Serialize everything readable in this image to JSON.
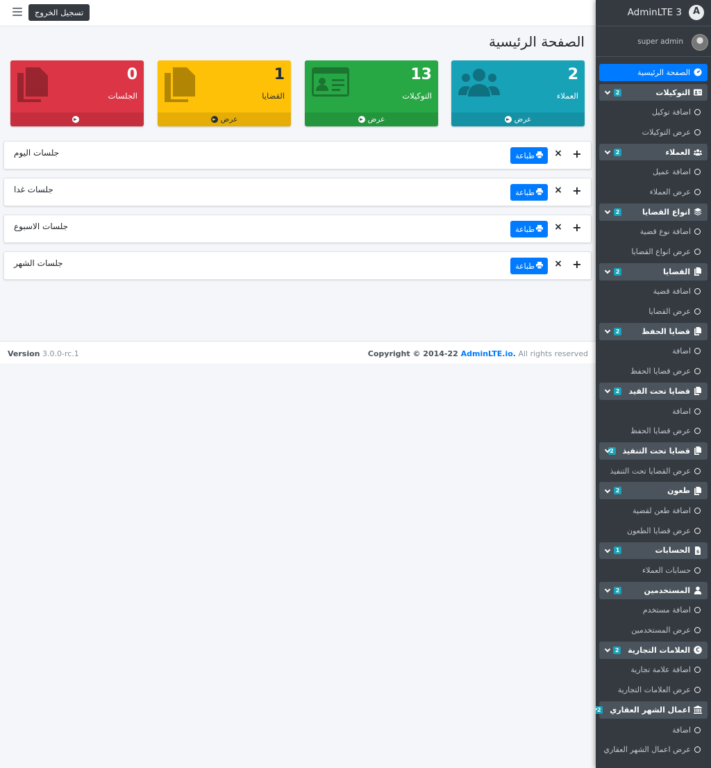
{
  "navbar": {
    "logout_label": "تسجيل الخروج",
    "menu_icon": "bars-icon"
  },
  "page": {
    "title": "الصفحة الرئيسية"
  },
  "stats": [
    {
      "value": "2",
      "label": "العملاء",
      "footer": "عرض",
      "color": "#17a2b8",
      "icon": "users-icon"
    },
    {
      "value": "13",
      "label": "التوكيلات",
      "footer": "عرض",
      "color": "#28a745",
      "icon": "id-card-icon"
    },
    {
      "value": "1",
      "label": "القضايا",
      "footer": "عرض",
      "color": "#ffc107",
      "icon": "copy-icon"
    },
    {
      "value": "0",
      "label": "الجلسات",
      "footer": "",
      "color": "#dc3545",
      "icon": "copy-icon"
    }
  ],
  "cards": [
    {
      "title": "جلسات اليوم",
      "print_label": "طباعة"
    },
    {
      "title": "جلسات غدا",
      "print_label": "طباعة"
    },
    {
      "title": "جلسات الاسبوع",
      "print_label": "طباعة"
    },
    {
      "title": "جلسات الشهر",
      "print_label": "طباعة"
    }
  ],
  "footer": {
    "version_label": "Version",
    "version": "3.0.0-rc.1",
    "copyright_prefix": "Copyright © 2014-22 ",
    "copyright_link": "AdminLTE.io.",
    "copyright_suffix": " All rights reserved"
  },
  "sidebar": {
    "brand": "AdminLTE 3",
    "user": "super admin",
    "home": "الصفحة الرئيسية",
    "groups": [
      {
        "label": "التوكيلات",
        "badge": "2",
        "icon": "id-card-icon",
        "items": [
          "اضافة توكيل",
          "عرض التوكيلات"
        ]
      },
      {
        "label": "العملاء",
        "badge": "2",
        "icon": "users-icon",
        "items": [
          "اضافة عميل",
          "عرض العملاء"
        ]
      },
      {
        "label": "انواع القضايا",
        "badge": "2",
        "icon": "layer-group-icon",
        "items": [
          "اضافة نوع قضية",
          "عرض انواع القضايا"
        ]
      },
      {
        "label": "القضايا",
        "badge": "2",
        "icon": "copy-icon",
        "items": [
          "اضافة قضية",
          "عرض القضايا"
        ]
      },
      {
        "label": "قضايا الحفظ",
        "badge": "2",
        "icon": "copy-icon",
        "items": [
          "اضافة",
          "عرض قضايا الحفظ"
        ]
      },
      {
        "label": "قضايا تحت القيد",
        "badge": "2",
        "icon": "copy-icon",
        "items": [
          "اضافة",
          "عرض قضايا الحفظ"
        ]
      },
      {
        "label": "قضايا تحت التنفيذ",
        "badge": "2",
        "icon": "copy-icon",
        "items": [
          "عرض القضايا تحت التنفيذ"
        ]
      },
      {
        "label": "طعون",
        "badge": "2",
        "icon": "copy-icon",
        "items": [
          "اضافة طعن لقضية",
          "عرض قضايا الطعون"
        ]
      },
      {
        "label": "الحسابات",
        "badge": "1",
        "icon": "file-invoice-icon",
        "items": [
          "حسابات العملاء"
        ]
      },
      {
        "label": "المستخدمين",
        "badge": "2",
        "icon": "user-icon",
        "items": [
          "اضافة مستخدم",
          "عرض المستخدمين"
        ]
      },
      {
        "label": "العلامات التجارية",
        "badge": "2",
        "icon": "copyright-icon",
        "items": [
          "اضافة علامة تجارية",
          "عرض العلامات التجارية"
        ]
      },
      {
        "label": "اعمال الشهر العقاري",
        "badge": "2",
        "icon": "landmark-icon",
        "items": [
          "اضافة",
          "عرض اعمال الشهر العقاري"
        ]
      }
    ]
  }
}
